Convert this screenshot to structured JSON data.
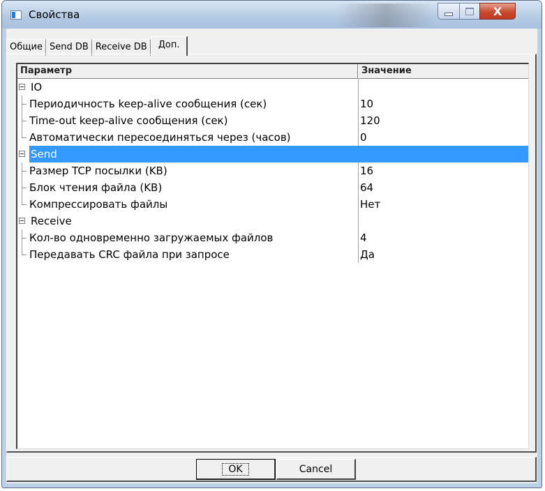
{
  "window": {
    "title": "Свойства",
    "close_glyph": "X"
  },
  "tabs": [
    {
      "label": "Общие",
      "active": false
    },
    {
      "label": "Send DB",
      "active": false
    },
    {
      "label": "Receive DB",
      "active": false
    },
    {
      "label": "Доп.",
      "active": true
    }
  ],
  "grid": {
    "headers": {
      "param": "Параметр",
      "value": "Значение"
    },
    "groups": [
      {
        "label": "IO",
        "selected": false,
        "items": [
          {
            "label": "Периодичность keep-alive сообщения (сек)",
            "value": "10"
          },
          {
            "label": "Time-out keep-alive сообщения (сек)",
            "value": "120"
          },
          {
            "label": "Автоматически пересоединяться через (часов)",
            "value": "0"
          }
        ]
      },
      {
        "label": "Send",
        "selected": true,
        "items": [
          {
            "label": "Размер TCP посылки (KB)",
            "value": "16"
          },
          {
            "label": "Блок чтения файла (KB)",
            "value": "64"
          },
          {
            "label": "Компрессировать файлы",
            "value": "Нет"
          }
        ]
      },
      {
        "label": "Receive",
        "selected": false,
        "items": [
          {
            "label": "Кол-во одновременно загружаемых файлов",
            "value": "4"
          },
          {
            "label": "Передавать CRC файла при запросе",
            "value": "Да"
          }
        ]
      }
    ]
  },
  "buttons": {
    "ok": "OK",
    "cancel": "Cancel"
  },
  "colors": {
    "selection": "#3399ff",
    "dialog_bg": "#f0f0f0",
    "close_button": "#c84a2f"
  }
}
